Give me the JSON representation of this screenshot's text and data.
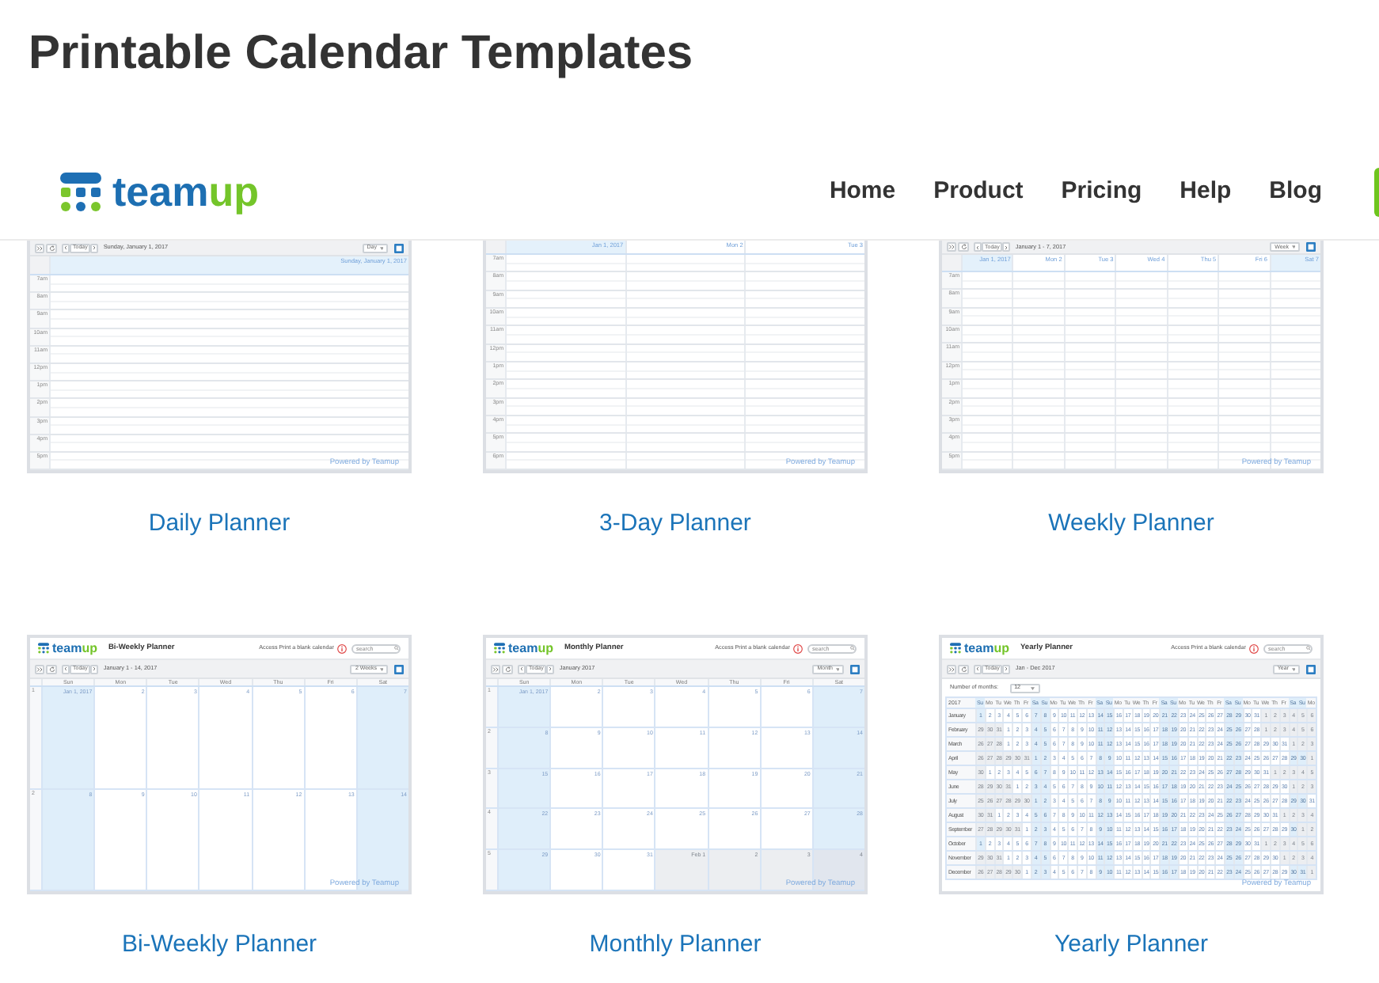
{
  "page": {
    "title": "Printable Calendar Templates"
  },
  "header": {
    "logo": {
      "primary": "team",
      "accent": "up"
    },
    "nav": [
      {
        "label": "Home"
      },
      {
        "label": "Product"
      },
      {
        "label": "Pricing"
      },
      {
        "label": "Help"
      },
      {
        "label": "Blog"
      }
    ]
  },
  "templates": [
    {
      "kind": "daily",
      "label": "Daily Planner",
      "preview": {
        "toolbar": {
          "today": "Today",
          "date_range": "Sunday, January 1, 2017",
          "view": "Day"
        },
        "columns": [
          {
            "heading": "Sunday, January 1, 2017",
            "highlighted": true
          }
        ],
        "hours": [
          "7am",
          "8am",
          "9am",
          "10am",
          "11am",
          "12pm",
          "1pm",
          "2pm",
          "3pm",
          "4pm",
          "5pm"
        ],
        "footer": "Powered by Teamup"
      }
    },
    {
      "kind": "three_day",
      "label": "3-Day Planner",
      "preview": {
        "columns": [
          {
            "heading": "Jan 1, 2017",
            "highlighted": true
          },
          {
            "heading": "Mon 2",
            "highlighted": false
          },
          {
            "heading": "Tue 3",
            "highlighted": false
          }
        ],
        "hours": [
          "7am",
          "8am",
          "9am",
          "10am",
          "11am",
          "12pm",
          "1pm",
          "2pm",
          "3pm",
          "4pm",
          "5pm",
          "6pm"
        ],
        "footer": "Powered by Teamup"
      }
    },
    {
      "kind": "weekly",
      "label": "Weekly Planner",
      "preview": {
        "toolbar": {
          "today": "Today",
          "date_range": "January 1 - 7, 2017",
          "view": "Week"
        },
        "columns": [
          {
            "heading": "Jan 1, 2017",
            "highlighted": true
          },
          {
            "heading": "Mon 2",
            "highlighted": false
          },
          {
            "heading": "Tue 3",
            "highlighted": false
          },
          {
            "heading": "Wed 4",
            "highlighted": false
          },
          {
            "heading": "Thu 5",
            "highlighted": false
          },
          {
            "heading": "Fri 6",
            "highlighted": false
          },
          {
            "heading": "Sat 7",
            "highlighted": true
          }
        ],
        "hours": [
          "7am",
          "8am",
          "9am",
          "10am",
          "11am",
          "12pm",
          "1pm",
          "2pm",
          "3pm",
          "4pm",
          "5pm"
        ],
        "footer": "Powered by Teamup"
      }
    },
    {
      "kind": "biweekly",
      "label": "Bi-Weekly Planner",
      "preview": {
        "title_bar": {
          "logo": {
            "primary": "team",
            "accent": "up"
          },
          "title": "Bi-Weekly Planner",
          "note": "Access Print a blank calendar",
          "search_placeholder": "search"
        },
        "toolbar": {
          "today": "Today",
          "date_range": "January 1 - 14, 2017",
          "view": "2 Weeks"
        },
        "weekdays": [
          "Sun",
          "Mon",
          "Tue",
          "Wed",
          "Thu",
          "Fri",
          "Sat"
        ],
        "weeks": [
          {
            "number": "1",
            "days": [
              {
                "text": "Jan 1, 2017",
                "weekend": true,
                "outside_month": false
              },
              {
                "text": "2",
                "weekend": false,
                "outside_month": false
              },
              {
                "text": "3",
                "weekend": false,
                "outside_month": false
              },
              {
                "text": "4",
                "weekend": false,
                "outside_month": false
              },
              {
                "text": "5",
                "weekend": false,
                "outside_month": false
              },
              {
                "text": "6",
                "weekend": false,
                "outside_month": false
              },
              {
                "text": "7",
                "weekend": true,
                "outside_month": false
              }
            ]
          },
          {
            "number": "2",
            "days": [
              {
                "text": "8",
                "weekend": true,
                "outside_month": false
              },
              {
                "text": "9",
                "weekend": false,
                "outside_month": false
              },
              {
                "text": "10",
                "weekend": false,
                "outside_month": false
              },
              {
                "text": "11",
                "weekend": false,
                "outside_month": false
              },
              {
                "text": "12",
                "weekend": false,
                "outside_month": false
              },
              {
                "text": "13",
                "weekend": false,
                "outside_month": false
              },
              {
                "text": "14",
                "weekend": true,
                "outside_month": false
              }
            ]
          }
        ],
        "footer": "Powered by Teamup"
      }
    },
    {
      "kind": "monthly",
      "label": "Monthly Planner",
      "preview": {
        "title_bar": {
          "logo": {
            "primary": "team",
            "accent": "up"
          },
          "title": "Monthly Planner",
          "note": "Access Print a blank calendar",
          "search_placeholder": "search"
        },
        "toolbar": {
          "today": "Today",
          "date_range": "January 2017",
          "view": "Month"
        },
        "weekdays": [
          "Sun",
          "Mon",
          "Tue",
          "Wed",
          "Thu",
          "Fri",
          "Sat"
        ],
        "weeks": [
          {
            "number": "1",
            "days": [
              {
                "text": "Jan 1, 2017",
                "weekend": true,
                "outside_month": false
              },
              {
                "text": "2",
                "weekend": false,
                "outside_month": false
              },
              {
                "text": "3",
                "weekend": false,
                "outside_month": false
              },
              {
                "text": "4",
                "weekend": false,
                "outside_month": false
              },
              {
                "text": "5",
                "weekend": false,
                "outside_month": false
              },
              {
                "text": "6",
                "weekend": false,
                "outside_month": false
              },
              {
                "text": "7",
                "weekend": true,
                "outside_month": false
              }
            ]
          },
          {
            "number": "2",
            "days": [
              {
                "text": "8",
                "weekend": true,
                "outside_month": false
              },
              {
                "text": "9",
                "weekend": false,
                "outside_month": false
              },
              {
                "text": "10",
                "weekend": false,
                "outside_month": false
              },
              {
                "text": "11",
                "weekend": false,
                "outside_month": false
              },
              {
                "text": "12",
                "weekend": false,
                "outside_month": false
              },
              {
                "text": "13",
                "weekend": false,
                "outside_month": false
              },
              {
                "text": "14",
                "weekend": true,
                "outside_month": false
              }
            ]
          },
          {
            "number": "3",
            "days": [
              {
                "text": "15",
                "weekend": true,
                "outside_month": false
              },
              {
                "text": "16",
                "weekend": false,
                "outside_month": false
              },
              {
                "text": "17",
                "weekend": false,
                "outside_month": false
              },
              {
                "text": "18",
                "weekend": false,
                "outside_month": false
              },
              {
                "text": "19",
                "weekend": false,
                "outside_month": false
              },
              {
                "text": "20",
                "weekend": false,
                "outside_month": false
              },
              {
                "text": "21",
                "weekend": true,
                "outside_month": false
              }
            ]
          },
          {
            "number": "4",
            "days": [
              {
                "text": "22",
                "weekend": true,
                "outside_month": false
              },
              {
                "text": "23",
                "weekend": false,
                "outside_month": false
              },
              {
                "text": "24",
                "weekend": false,
                "outside_month": false
              },
              {
                "text": "25",
                "weekend": false,
                "outside_month": false
              },
              {
                "text": "26",
                "weekend": false,
                "outside_month": false
              },
              {
                "text": "27",
                "weekend": false,
                "outside_month": false
              },
              {
                "text": "28",
                "weekend": true,
                "outside_month": false
              }
            ]
          },
          {
            "number": "5",
            "days": [
              {
                "text": "29",
                "weekend": true,
                "outside_month": false
              },
              {
                "text": "30",
                "weekend": false,
                "outside_month": false
              },
              {
                "text": "31",
                "weekend": false,
                "outside_month": false
              },
              {
                "text": "Feb 1",
                "weekend": false,
                "outside_month": true
              },
              {
                "text": "2",
                "weekend": false,
                "outside_month": true
              },
              {
                "text": "3",
                "weekend": false,
                "outside_month": true
              },
              {
                "text": "4",
                "weekend": true,
                "outside_month": true
              }
            ]
          }
        ],
        "footer": "Powered by Teamup"
      }
    },
    {
      "kind": "yearly",
      "label": "Yearly Planner",
      "preview": {
        "title_bar": {
          "logo": {
            "primary": "team",
            "accent": "up"
          },
          "title": "Yearly Planner",
          "note": "Access Print a blank calendar",
          "search_placeholder": "search"
        },
        "toolbar": {
          "today": "Today",
          "date_range": "Jan - Dec 2017",
          "view": "Year"
        },
        "months_setting": {
          "label": "Number of months:",
          "value": "12"
        },
        "corner": "2017",
        "weekdays": [
          {
            "label": "Su",
            "weekend": true
          },
          {
            "label": "Mo",
            "weekend": false
          },
          {
            "label": "Tu",
            "weekend": false
          },
          {
            "label": "We",
            "weekend": false
          },
          {
            "label": "Th",
            "weekend": false
          },
          {
            "label": "Fr",
            "weekend": false
          },
          {
            "label": "Sa",
            "weekend": true
          },
          {
            "label": "Su",
            "weekend": true
          },
          {
            "label": "Mo",
            "weekend": false
          },
          {
            "label": "Tu",
            "weekend": false
          },
          {
            "label": "We",
            "weekend": false
          },
          {
            "label": "Th",
            "weekend": false
          },
          {
            "label": "Fr",
            "weekend": false
          },
          {
            "label": "Sa",
            "weekend": true
          },
          {
            "label": "Su",
            "weekend": true
          },
          {
            "label": "Mo",
            "weekend": false
          },
          {
            "label": "Tu",
            "weekend": false
          },
          {
            "label": "We",
            "weekend": false
          },
          {
            "label": "Th",
            "weekend": false
          },
          {
            "label": "Fr",
            "weekend": false
          },
          {
            "label": "Sa",
            "weekend": true
          },
          {
            "label": "Su",
            "weekend": true
          },
          {
            "label": "Mo",
            "weekend": false
          },
          {
            "label": "Tu",
            "weekend": false
          },
          {
            "label": "We",
            "weekend": false
          },
          {
            "label": "Th",
            "weekend": false
          },
          {
            "label": "Fr",
            "weekend": false
          },
          {
            "label": "Sa",
            "weekend": true
          },
          {
            "label": "Su",
            "weekend": true
          },
          {
            "label": "Mo",
            "weekend": false
          },
          {
            "label": "Tu",
            "weekend": false
          },
          {
            "label": "We",
            "weekend": false
          },
          {
            "label": "Th",
            "weekend": false
          },
          {
            "label": "Fr",
            "weekend": false
          },
          {
            "label": "Sa",
            "weekend": true
          },
          {
            "label": "Su",
            "weekend": true
          },
          {
            "label": "Mo",
            "weekend": false
          }
        ],
        "months": [
          {
            "name": "January",
            "days": [
              "1",
              "2",
              "3",
              "4",
              "5",
              "6",
              "7",
              "8",
              "9",
              "10",
              "11",
              "12",
              "13",
              "14",
              "15",
              "16",
              "17",
              "18",
              "19",
              "20",
              "21",
              "22",
              "23",
              "24",
              "25",
              "26",
              "27",
              "28",
              "29",
              "30",
              "31"
            ],
            "after": [
              "1",
              "2",
              "3",
              "4",
              "5",
              "6"
            ]
          },
          {
            "name": "February",
            "before": [
              "29",
              "30",
              "31"
            ],
            "days": [
              "1",
              "2",
              "3",
              "4",
              "5",
              "6",
              "7",
              "8",
              "9",
              "10",
              "11",
              "12",
              "13",
              "14",
              "15",
              "16",
              "17",
              "18",
              "19",
              "20",
              "21",
              "22",
              "23",
              "24",
              "25",
              "26",
              "27",
              "28"
            ],
            "after": [
              "1",
              "2",
              "3",
              "4",
              "5",
              "6"
            ]
          },
          {
            "name": "March",
            "before": [
              "26",
              "27",
              "28"
            ],
            "days": [
              "1",
              "2",
              "3",
              "4",
              "5",
              "6",
              "7",
              "8",
              "9",
              "10",
              "11",
              "12",
              "13",
              "14",
              "15",
              "16",
              "17",
              "18",
              "19",
              "20",
              "21",
              "22",
              "23",
              "24",
              "25",
              "26",
              "27",
              "28",
              "29",
              "30",
              "31"
            ],
            "after": [
              "1",
              "2",
              "3"
            ]
          },
          {
            "name": "April",
            "before": [
              "26",
              "27",
              "28",
              "29",
              "30",
              "31"
            ],
            "days": [
              "1",
              "2",
              "3",
              "4",
              "5",
              "6",
              "7",
              "8",
              "9",
              "10",
              "11",
              "12",
              "13",
              "14",
              "15",
              "16",
              "17",
              "18",
              "19",
              "20",
              "21",
              "22",
              "23",
              "24",
              "25",
              "26",
              "27",
              "28",
              "29",
              "30"
            ],
            "after": [
              "1"
            ]
          },
          {
            "name": "May",
            "before": [
              "30"
            ],
            "days": [
              "1",
              "2",
              "3",
              "4",
              "5",
              "6",
              "7",
              "8",
              "9",
              "10",
              "11",
              "12",
              "13",
              "14",
              "15",
              "16",
              "17",
              "18",
              "19",
              "20",
              "21",
              "22",
              "23",
              "24",
              "25",
              "26",
              "27",
              "28",
              "29",
              "30",
              "31"
            ],
            "after": [
              "1",
              "2",
              "3",
              "4",
              "5"
            ]
          },
          {
            "name": "June",
            "before": [
              "28",
              "29",
              "30",
              "31"
            ],
            "days": [
              "1",
              "2",
              "3",
              "4",
              "5",
              "6",
              "7",
              "8",
              "9",
              "10",
              "11",
              "12",
              "13",
              "14",
              "15",
              "16",
              "17",
              "18",
              "19",
              "20",
              "21",
              "22",
              "23",
              "24",
              "25",
              "26",
              "27",
              "28",
              "29",
              "30"
            ],
            "after": [
              "1",
              "2",
              "3"
            ]
          },
          {
            "name": "July",
            "before": [
              "25",
              "26",
              "27",
              "28",
              "29",
              "30"
            ],
            "days": [
              "1",
              "2",
              "3",
              "4",
              "5",
              "6",
              "7",
              "8",
              "9",
              "10",
              "11",
              "12",
              "13",
              "14",
              "15",
              "16",
              "17",
              "18",
              "19",
              "20",
              "21",
              "22",
              "23",
              "24",
              "25",
              "26",
              "27",
              "28",
              "29",
              "30",
              "31"
            ]
          },
          {
            "name": "August",
            "before": [
              "30",
              "31"
            ],
            "days": [
              "1",
              "2",
              "3",
              "4",
              "5",
              "6",
              "7",
              "8",
              "9",
              "10",
              "11",
              "12",
              "13",
              "14",
              "15",
              "16",
              "17",
              "18",
              "19",
              "20",
              "21",
              "22",
              "23",
              "24",
              "25",
              "26",
              "27",
              "28",
              "29",
              "30",
              "31"
            ],
            "after": [
              "1",
              "2",
              "3",
              "4"
            ]
          },
          {
            "name": "September",
            "before": [
              "27",
              "28",
              "29",
              "30",
              "31"
            ],
            "days": [
              "1",
              "2",
              "3",
              "4",
              "5",
              "6",
              "7",
              "8",
              "9",
              "10",
              "11",
              "12",
              "13",
              "14",
              "15",
              "16",
              "17",
              "18",
              "19",
              "20",
              "21",
              "22",
              "23",
              "24",
              "25",
              "26",
              "27",
              "28",
              "29",
              "30"
            ],
            "after": [
              "1",
              "2"
            ]
          },
          {
            "name": "October",
            "days": [
              "1",
              "2",
              "3",
              "4",
              "5",
              "6",
              "7",
              "8",
              "9",
              "10",
              "11",
              "12",
              "13",
              "14",
              "15",
              "16",
              "17",
              "18",
              "19",
              "20",
              "21",
              "22",
              "23",
              "24",
              "25",
              "26",
              "27",
              "28",
              "29",
              "30",
              "31"
            ],
            "after": [
              "1",
              "2",
              "3",
              "4",
              "5",
              "6"
            ]
          },
          {
            "name": "November",
            "before": [
              "29",
              "30",
              "31"
            ],
            "days": [
              "1",
              "2",
              "3",
              "4",
              "5",
              "6",
              "7",
              "8",
              "9",
              "10",
              "11",
              "12",
              "13",
              "14",
              "15",
              "16",
              "17",
              "18",
              "19",
              "20",
              "21",
              "22",
              "23",
              "24",
              "25",
              "26",
              "27",
              "28",
              "29",
              "30"
            ],
            "after": [
              "1",
              "2",
              "3",
              "4"
            ]
          },
          {
            "name": "December",
            "before": [
              "26",
              "27",
              "28",
              "29",
              "30"
            ],
            "days": [
              "1",
              "2",
              "3",
              "4",
              "5",
              "6",
              "7",
              "8",
              "9",
              "10",
              "11",
              "12",
              "13",
              "14",
              "15",
              "16",
              "17",
              "18",
              "19",
              "20",
              "21",
              "22",
              "23",
              "24",
              "25",
              "26",
              "27",
              "28",
              "29",
              "30",
              "31"
            ],
            "after": [
              "1"
            ]
          }
        ],
        "footer": "Powered by Teamup"
      }
    }
  ]
}
